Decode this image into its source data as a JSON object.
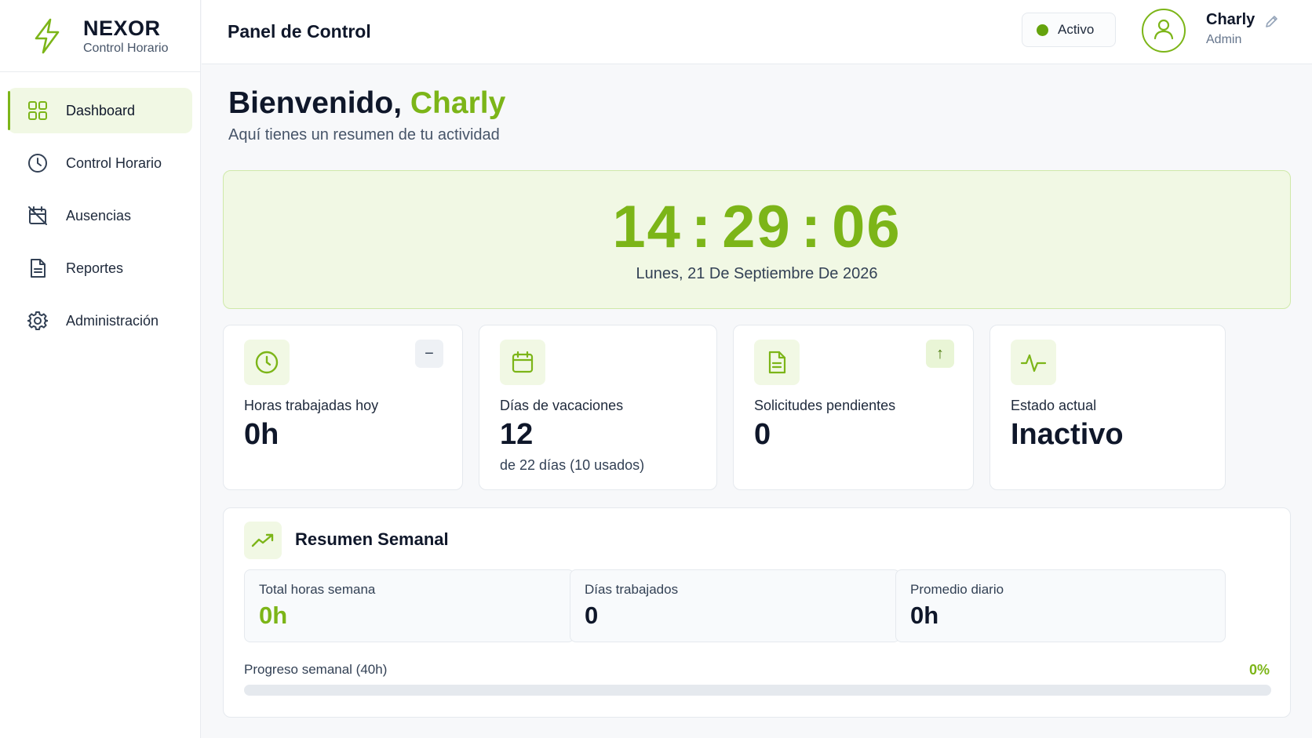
{
  "brand": {
    "name": "NEXOR",
    "subtitle": "Control Horario",
    "icon": "lightning-bolt-icon"
  },
  "sidebar": {
    "items": [
      {
        "label": "Dashboard",
        "icon": "grid-icon",
        "active": true
      },
      {
        "label": "Control Horario",
        "icon": "clock-icon",
        "active": false
      },
      {
        "label": "Ausencias",
        "icon": "calendar-off-icon",
        "active": false
      },
      {
        "label": "Reportes",
        "icon": "document-icon",
        "active": false
      },
      {
        "label": "Administración",
        "icon": "gear-icon",
        "active": false
      }
    ]
  },
  "header": {
    "title": "Panel de Control",
    "status": "Activo",
    "user_name": "Charly",
    "user_role": "Admin"
  },
  "welcome": {
    "greeting": "Bienvenido,",
    "name": "Charly",
    "subtitle": "Aquí tienes un resumen de tu actividad"
  },
  "clock": {
    "hours": "14",
    "minutes": "29",
    "seconds": "06",
    "separator": ":",
    "date": "Lunes, 21 De Septiembre De 2026"
  },
  "stats": [
    {
      "label": "Horas trabajadas hoy",
      "value": "0h",
      "badge": "−",
      "icon": "clock-icon"
    },
    {
      "label": "Días de vacaciones",
      "value": "12",
      "sub": "de 22 días (10 usados)",
      "icon": "calendar-icon"
    },
    {
      "label": "Solicitudes pendientes",
      "value": "0",
      "badge": "↑",
      "icon": "document-icon"
    },
    {
      "label": "Estado actual",
      "value": "Inactivo",
      "icon": "activity-icon"
    }
  ],
  "weekly": {
    "title": "Resumen Semanal",
    "items": [
      {
        "label": "Total horas semana",
        "value": "0h"
      },
      {
        "label": "Días trabajados",
        "value": "0"
      },
      {
        "label": "Promedio diario",
        "value": "0h"
      }
    ],
    "progress_label": "Progreso semanal (40h)",
    "progress_text": "0%",
    "progress_value": 0
  },
  "colors": {
    "accent": "#7cb518",
    "accent_light": "#f1f8e4",
    "text_dark": "#0f172a",
    "status_dot": "#65a30d"
  }
}
